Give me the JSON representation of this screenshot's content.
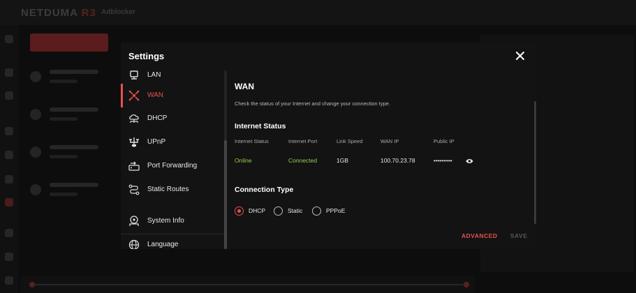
{
  "background": {
    "app_name": "NETDUMA",
    "app_name_suffix": "R3",
    "page": "Adblocker"
  },
  "modal": {
    "title": "Settings"
  },
  "sidebar": {
    "items": [
      {
        "label": "LAN",
        "icon": "lan-icon"
      },
      {
        "label": "WAN",
        "icon": "wan-icon",
        "active": true
      },
      {
        "label": "DHCP",
        "icon": "dhcp-icon"
      },
      {
        "label": "UPnP",
        "icon": "upnp-icon"
      },
      {
        "label": "Port Forwarding",
        "icon": "port-forwarding-icon"
      },
      {
        "label": "Static Routes",
        "icon": "static-routes-icon"
      },
      {
        "label": "System Info",
        "icon": "system-info-icon"
      },
      {
        "label": "Language",
        "icon": "globe-icon"
      }
    ]
  },
  "wan": {
    "title": "WAN",
    "description": "Check the status of your Internet and change your connection type.",
    "status_title": "Internet Status",
    "columns": [
      "Internet Status",
      "Internet Port",
      "Link Speed",
      "WAN IP",
      "Public IP"
    ],
    "values": {
      "internet_status": "Online",
      "internet_port": "Connected",
      "link_speed": "1GB",
      "wan_ip": "100.70.23.78",
      "public_ip": "•••••••••"
    },
    "connection_type_title": "Connection Type",
    "connection_types": [
      "DHCP",
      "Static",
      "PPPoE"
    ],
    "selected_connection_type": "DHCP"
  },
  "actions": {
    "advanced": "ADVANCED",
    "save": "SAVE"
  },
  "colors": {
    "accent": "#e8504e",
    "status_ok": "#8fd14f"
  }
}
